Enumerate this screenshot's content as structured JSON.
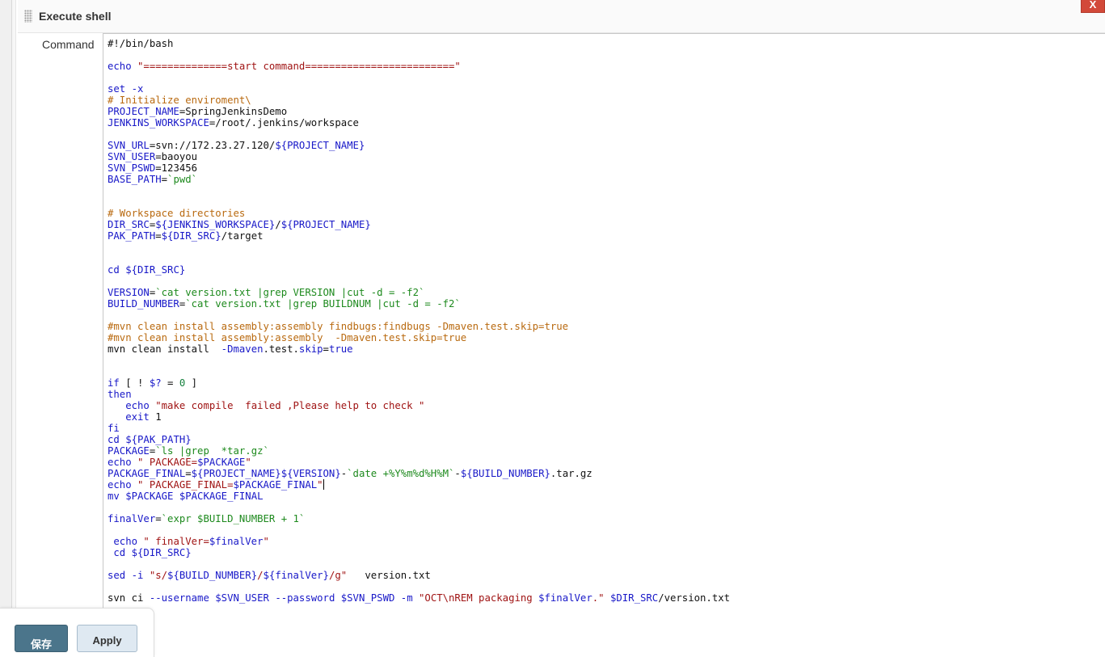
{
  "section": {
    "title": "Execute shell",
    "close_label": "X",
    "command_label": "Command"
  },
  "code_lines": [
    [
      {
        "t": "#!/bin/bash",
        "c": ""
      }
    ],
    [],
    [
      {
        "t": "echo ",
        "c": "kw"
      },
      {
        "t": "\"==============start command=========================\"",
        "c": "str"
      }
    ],
    [],
    [
      {
        "t": "set -x",
        "c": "kw"
      }
    ],
    [
      {
        "t": "# Initialize enviroment\\",
        "c": "cmt"
      }
    ],
    [
      {
        "t": "PROJECT_NAME",
        "c": "vr"
      },
      {
        "t": "=SpringJenkinsDemo",
        "c": ""
      }
    ],
    [
      {
        "t": "JENKINS_WORKSPACE",
        "c": "vr"
      },
      {
        "t": "=/root/.jenkins/workspace",
        "c": ""
      }
    ],
    [],
    [
      {
        "t": "SVN_URL",
        "c": "vr"
      },
      {
        "t": "=svn://172.23.27.120/",
        "c": ""
      },
      {
        "t": "${PROJECT_NAME}",
        "c": "vr"
      }
    ],
    [
      {
        "t": "SVN_USER",
        "c": "vr"
      },
      {
        "t": "=baoyou",
        "c": ""
      }
    ],
    [
      {
        "t": "SVN_PSWD",
        "c": "vr"
      },
      {
        "t": "=123456",
        "c": ""
      }
    ],
    [
      {
        "t": "BASE_PATH",
        "c": "vr"
      },
      {
        "t": "=",
        "c": ""
      },
      {
        "t": "`pwd`",
        "c": "bq"
      }
    ],
    [],
    [],
    [
      {
        "t": "# Workspace directories",
        "c": "cmt"
      }
    ],
    [
      {
        "t": "DIR_SRC",
        "c": "vr"
      },
      {
        "t": "=",
        "c": ""
      },
      {
        "t": "${JENKINS_WORKSPACE}",
        "c": "vr"
      },
      {
        "t": "/",
        "c": ""
      },
      {
        "t": "${PROJECT_NAME}",
        "c": "vr"
      }
    ],
    [
      {
        "t": "PAK_PATH",
        "c": "vr"
      },
      {
        "t": "=",
        "c": ""
      },
      {
        "t": "${DIR_SRC}",
        "c": "vr"
      },
      {
        "t": "/target",
        "c": ""
      }
    ],
    [],
    [],
    [
      {
        "t": "cd ",
        "c": "kw"
      },
      {
        "t": "${DIR_SRC}",
        "c": "vr"
      }
    ],
    [],
    [
      {
        "t": "VERSION",
        "c": "vr"
      },
      {
        "t": "=",
        "c": ""
      },
      {
        "t": "`cat version.txt |grep VERSION |cut -d = -f2`",
        "c": "bq"
      }
    ],
    [
      {
        "t": "BUILD_NUMBER",
        "c": "vr"
      },
      {
        "t": "=",
        "c": ""
      },
      {
        "t": "`cat version.txt |grep BUILDNUM |cut -d = -f2`",
        "c": "bq"
      }
    ],
    [],
    [
      {
        "t": "#mvn clean install assembly:assembly findbugs:findbugs -Dmaven.test.skip=true",
        "c": "cmt"
      }
    ],
    [
      {
        "t": "#mvn clean install assembly:assembly  -Dmaven.test.skip=true",
        "c": "cmt"
      }
    ],
    [
      {
        "t": "mvn clean install  ",
        "c": ""
      },
      {
        "t": "-Dmaven",
        "c": "kw"
      },
      {
        "t": ".test.",
        "c": ""
      },
      {
        "t": "skip",
        "c": "kw"
      },
      {
        "t": "=",
        "c": ""
      },
      {
        "t": "true",
        "c": "kw"
      }
    ],
    [],
    [],
    [
      {
        "t": "if",
        "c": "kw"
      },
      {
        "t": " [ ! ",
        "c": ""
      },
      {
        "t": "$?",
        "c": "vr"
      },
      {
        "t": " = ",
        "c": ""
      },
      {
        "t": "0",
        "c": "num"
      },
      {
        "t": " ]",
        "c": ""
      }
    ],
    [
      {
        "t": "then",
        "c": "kw"
      }
    ],
    [
      {
        "t": "   echo ",
        "c": "kw"
      },
      {
        "t": "\"make compile  failed ,Please help to check \"",
        "c": "str"
      }
    ],
    [
      {
        "t": "   exit ",
        "c": "kw"
      },
      {
        "t": "1",
        "c": ""
      }
    ],
    [
      {
        "t": "fi",
        "c": "kw"
      }
    ],
    [
      {
        "t": "cd ",
        "c": "kw"
      },
      {
        "t": "${PAK_PATH}",
        "c": "vr"
      }
    ],
    [
      {
        "t": "PACKAGE",
        "c": "vr"
      },
      {
        "t": "=",
        "c": ""
      },
      {
        "t": "`ls |grep  *tar.gz`",
        "c": "bq"
      }
    ],
    [
      {
        "t": "echo ",
        "c": "kw"
      },
      {
        "t": "\" PACKAGE=",
        "c": "str"
      },
      {
        "t": "$PACKAGE",
        "c": "vr"
      },
      {
        "t": "\"",
        "c": "str"
      }
    ],
    [
      {
        "t": "PACKAGE_FINAL",
        "c": "vr"
      },
      {
        "t": "=",
        "c": ""
      },
      {
        "t": "${PROJECT_NAME}${VERSION}",
        "c": "vr"
      },
      {
        "t": "-",
        "c": ""
      },
      {
        "t": "`date +%Y%m%d%H%M`",
        "c": "bq"
      },
      {
        "t": "-",
        "c": ""
      },
      {
        "t": "${BUILD_NUMBER}",
        "c": "vr"
      },
      {
        "t": ".tar.gz",
        "c": ""
      }
    ],
    [
      {
        "t": "echo ",
        "c": "kw"
      },
      {
        "t": "\" PACKAGE_FINAL=",
        "c": "str"
      },
      {
        "t": "$PACKAGE_FINAL",
        "c": "vr"
      },
      {
        "t": "\"",
        "c": "str"
      },
      {
        "t": "|",
        "c": "cursor"
      }
    ],
    [
      {
        "t": "mv ",
        "c": "kw"
      },
      {
        "t": "$PACKAGE $PACKAGE_FINAL",
        "c": "vr"
      }
    ],
    [],
    [
      {
        "t": "finalVer",
        "c": "vr"
      },
      {
        "t": "=",
        "c": ""
      },
      {
        "t": "`expr $BUILD_NUMBER + 1`",
        "c": "bq"
      }
    ],
    [],
    [
      {
        "t": " echo ",
        "c": "kw"
      },
      {
        "t": "\" finalVer=",
        "c": "str"
      },
      {
        "t": "$finalVer",
        "c": "vr"
      },
      {
        "t": "\"",
        "c": "str"
      }
    ],
    [
      {
        "t": " cd ",
        "c": "kw"
      },
      {
        "t": "${DIR_SRC}",
        "c": "vr"
      }
    ],
    [],
    [
      {
        "t": "sed -i ",
        "c": "kw"
      },
      {
        "t": "\"s/",
        "c": "str"
      },
      {
        "t": "${BUILD_NUMBER}",
        "c": "vr"
      },
      {
        "t": "/",
        "c": "str"
      },
      {
        "t": "${finalVer}",
        "c": "vr"
      },
      {
        "t": "/g\"",
        "c": "str"
      },
      {
        "t": "   version.txt",
        "c": ""
      }
    ],
    [],
    [
      {
        "t": "svn ci ",
        "c": ""
      },
      {
        "t": "--username ",
        "c": "kw"
      },
      {
        "t": "$SVN_USER ",
        "c": "vr"
      },
      {
        "t": "--password ",
        "c": "kw"
      },
      {
        "t": "$SVN_PSWD ",
        "c": "vr"
      },
      {
        "t": "-m ",
        "c": "kw"
      },
      {
        "t": "\"OCT\\nREM packaging ",
        "c": "str"
      },
      {
        "t": "$finalVer",
        "c": "vr"
      },
      {
        "t": ".\"",
        "c": "str"
      },
      {
        "t": " ",
        "c": ""
      },
      {
        "t": "$DIR_SRC",
        "c": "vr"
      },
      {
        "t": "/version.txt",
        "c": ""
      }
    ]
  ],
  "footer": {
    "save_label": "保存",
    "apply_label": "Apply"
  }
}
